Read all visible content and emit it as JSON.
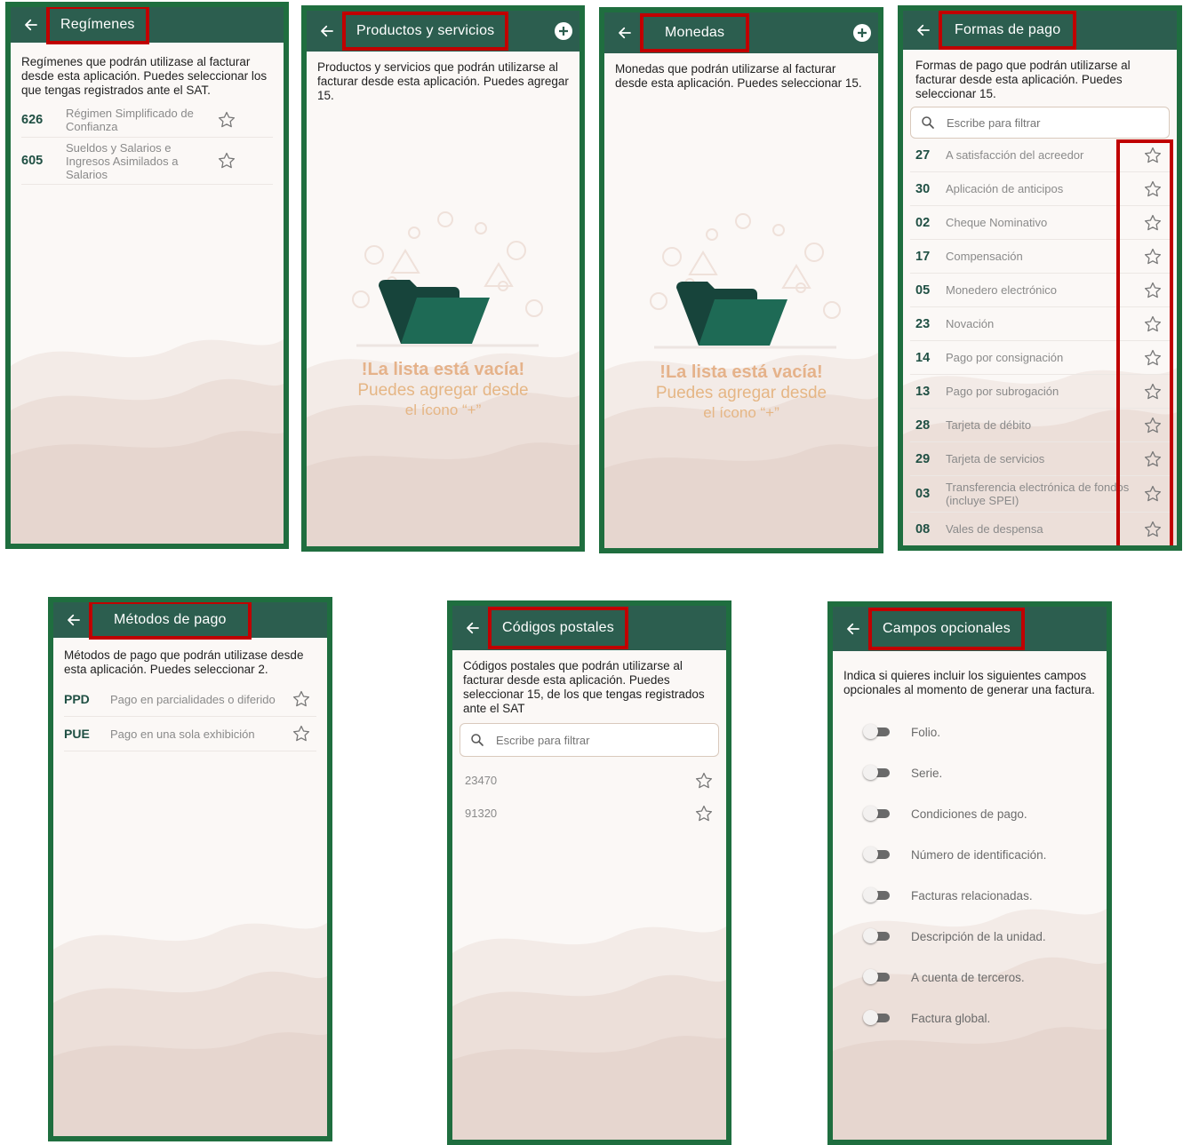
{
  "colors": {
    "frame": "#1f6e3f",
    "header": "#2c5e4f",
    "highlight": "#c00000",
    "code": "#1f4f43",
    "empty_text": "#e5b685"
  },
  "icons": {
    "back": "arrow-left-icon",
    "add": "plus-circle-icon",
    "favorite": "star-outline-icon",
    "search": "search-icon",
    "empty": "empty-folder-icon"
  },
  "regimenes": {
    "title": "Regímenes",
    "description": "Regímenes que podrán utilizase al facturar desde esta aplicación. Puedes seleccionar los que  tengas registrados ante el SAT.",
    "items": [
      {
        "code": "626",
        "name": "Régimen Simplificado de Confianza"
      },
      {
        "code": "605",
        "name": "Sueldos y Salarios e Ingresos Asimilados a Salarios"
      }
    ]
  },
  "productos": {
    "title": "Productos y servicios",
    "description": "Productos y servicios que podrán utilizarse al facturar desde esta aplicación. Puedes agregar 15.",
    "empty_title": "!La lista está vacía!",
    "empty_line1": "Puedes agregar desde",
    "empty_line2": "el ícono “+”"
  },
  "monedas": {
    "title": "Monedas",
    "description": "Monedas que podrán utilizarse al facturar desde esta aplicación. Puedes seleccionar 15.",
    "empty_title": "!La lista está vacía!",
    "empty_line1": "Puedes agregar desde",
    "empty_line2": "el ícono “+”"
  },
  "formas": {
    "title": "Formas de pago",
    "description": "Formas de pago que podrán utilizarse al facturar desde esta aplicación. Puedes seleccionar 15.",
    "search_placeholder": "Escribe para filtrar",
    "items": [
      {
        "code": "27",
        "name": "A satisfacción del acreedor"
      },
      {
        "code": "30",
        "name": "Aplicación de anticipos"
      },
      {
        "code": "02",
        "name": "Cheque Nominativo"
      },
      {
        "code": "17",
        "name": "Compensación"
      },
      {
        "code": "05",
        "name": "Monedero electrónico"
      },
      {
        "code": "23",
        "name": "Novación"
      },
      {
        "code": "14",
        "name": "Pago por consignación"
      },
      {
        "code": "13",
        "name": "Pago por subrogación"
      },
      {
        "code": "28",
        "name": "Tarjeta de débito"
      },
      {
        "code": "29",
        "name": "Tarjeta de servicios"
      },
      {
        "code": "03",
        "name": "Transferencia electrónica de fondos (incluye SPEI)"
      },
      {
        "code": "08",
        "name": "Vales de despensa"
      }
    ]
  },
  "metodos": {
    "title": "Métodos de pago",
    "description": "Métodos de pago que podrán utilizase desde esta aplicación. Puedes seleccionar 2.",
    "items": [
      {
        "code": "PPD",
        "name": "Pago en parcialidades o diferido"
      },
      {
        "code": "PUE",
        "name": "Pago en una sola exhibición"
      }
    ]
  },
  "codigos": {
    "title": "Códigos postales",
    "description": "Códigos postales que podrán utilizarse al facturar desde esta aplicación. Puedes seleccionar 15, de los que tengas registrados ante el SAT",
    "search_placeholder": "Escribe para filtrar",
    "items": [
      "23470",
      "91320"
    ]
  },
  "campos": {
    "title": "Campos opcionales",
    "description": "Indica si quieres incluir los siguientes campos opcionales al momento de generar una factura.",
    "items": [
      "Folio.",
      "Serie.",
      "Condiciones de pago.",
      "Número de identificación.",
      "Facturas relacionadas.",
      "Descripción de la unidad.",
      "A cuenta de terceros.",
      "Factura global."
    ]
  }
}
